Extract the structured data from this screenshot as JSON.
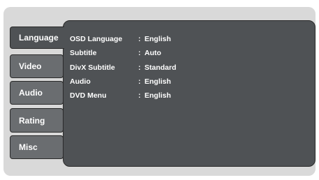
{
  "tabs": [
    {
      "label": "Language",
      "active": true
    },
    {
      "label": "Video",
      "active": false
    },
    {
      "label": "Audio",
      "active": false
    },
    {
      "label": "Rating",
      "active": false
    },
    {
      "label": "Misc",
      "active": false
    }
  ],
  "settings": [
    {
      "label": "OSD Language",
      "separator": ":",
      "value": "English"
    },
    {
      "label": "Subtitle",
      "separator": ":",
      "value": "Auto"
    },
    {
      "label": "DivX Subtitle",
      "separator": ":",
      "value": "Standard"
    },
    {
      "label": "Audio",
      "separator": ":",
      "value": "English"
    },
    {
      "label": "DVD Menu",
      "separator": ":",
      "value": "English"
    }
  ],
  "colors": {
    "frame": "#d9d9d9",
    "panel": "#4f5255",
    "tab": "#6a6d70",
    "text": "#ffffff"
  }
}
